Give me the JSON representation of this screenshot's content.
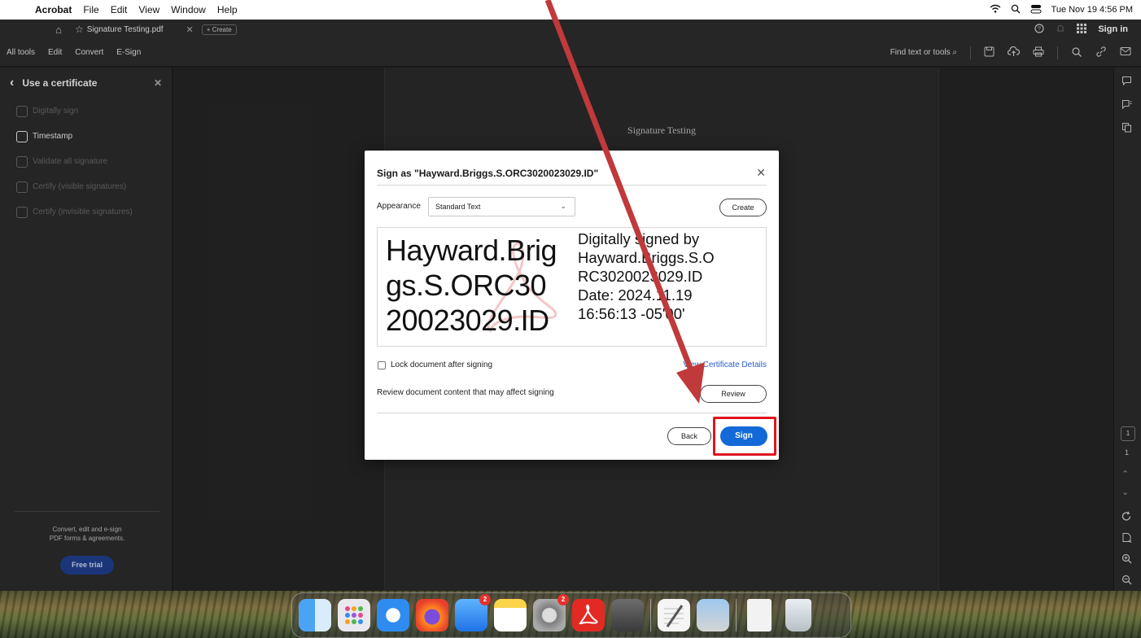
{
  "menubar": {
    "app_name": "Acrobat",
    "menus": [
      "File",
      "Edit",
      "View",
      "Window",
      "Help"
    ],
    "clock": "Tue Nov 19  4:56 PM"
  },
  "tabbar": {
    "tab_name": "Signature Testing.pdf",
    "new_tab_label": "+ Create",
    "sign_in": "Sign in"
  },
  "toolbar": {
    "tools": [
      "All tools",
      "Edit",
      "Convert",
      "E-Sign"
    ],
    "find_label": "Find text or tools"
  },
  "left_panel": {
    "title": "Use a certificate",
    "items": [
      {
        "label": "Digitally sign",
        "enabled": false
      },
      {
        "label": "Timestamp",
        "enabled": true
      },
      {
        "label": "Validate all signature",
        "enabled": false
      },
      {
        "label": "Certify (visible signatures)",
        "enabled": false
      },
      {
        "label": "Certify (invisible signatures)",
        "enabled": false
      }
    ],
    "promo_line1": "Convert, edit and e-sign",
    "promo_line2": "PDF forms & agreements.",
    "trial_button": "Free trial"
  },
  "document": {
    "title": "Signature Testing",
    "page_number": "1",
    "page_total": "1"
  },
  "dialog": {
    "title": "Sign as \"Hayward.Briggs.S.ORC3020023029.ID\"",
    "appearance_label": "Appearance",
    "appearance_value": "Standard Text",
    "create_button": "Create",
    "preview_name_lines": [
      "Hayward.Brig",
      "gs.S.ORC30",
      "20023029.ID"
    ],
    "preview_info_lines": [
      "Digitally signed by",
      "Hayward.Briggs.S.O",
      "RC3020023029.ID",
      "Date: 2024.11.19",
      "16:56:13 -05'00'"
    ],
    "lock_label": "Lock document after signing",
    "lock_checked": false,
    "certificate_link": "View Certificate Details",
    "review_text": "Review document content that may affect signing",
    "review_button": "Review",
    "back_button": "Back",
    "sign_button": "Sign"
  },
  "dock": {
    "mail_badge": "2",
    "settings_badge": "2"
  },
  "colors": {
    "accent_blue": "#1469d8",
    "highlight_red": "#e0141e",
    "arrow_red": "#c0393b",
    "link_blue": "#2b61c8"
  }
}
